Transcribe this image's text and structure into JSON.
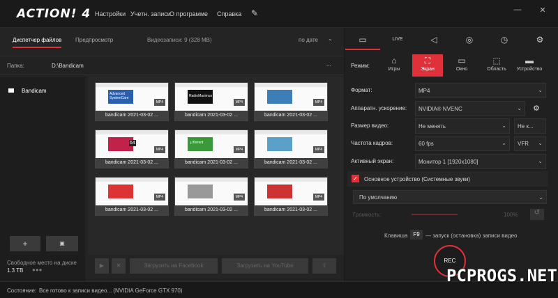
{
  "app": {
    "logo": "ACTION! 4"
  },
  "menu": [
    "Настройки",
    "Учетн. записи",
    "О программе",
    "Справка"
  ],
  "window": {
    "minimize": "—",
    "close": "✕"
  },
  "tabs": {
    "files": "Диспетчер файлов",
    "preview": "Предпросмотр",
    "count": "Видеозаписи: 9 (328 MB)",
    "sort": "по дате"
  },
  "path": {
    "label": "Папка:",
    "value": "D:\\Bandicam",
    "more": "..."
  },
  "folders": [
    {
      "name": "Bandicam"
    }
  ],
  "thumbs": [
    {
      "name": "bandicam 2021-03-02 ...",
      "fmt": "MP4",
      "logo": "Advanced SystemCare",
      "color": "#2a5fb0"
    },
    {
      "name": "bandicam 2021-03-02 ...",
      "fmt": "MP4",
      "logo": "RadioMaximus",
      "color": "#111"
    },
    {
      "name": "bandicam 2021-03-02 ...",
      "fmt": "MP4",
      "logo": "",
      "color": "#3c7fb8"
    },
    {
      "name": "bandicam 2021-03-02 ...",
      "fmt": "MP4",
      "logo": "64",
      "color": "#c0224a"
    },
    {
      "name": "bandicam 2021-03-02 ...",
      "fmt": "MP4",
      "logo": "μTorrent",
      "color": "#3a9a3a"
    },
    {
      "name": "bandicam 2021-03-02 ...",
      "fmt": "MP4",
      "logo": "",
      "color": "#5aa0c8"
    },
    {
      "name": "bandicam 2021-03-02 ...",
      "fmt": "MP4",
      "logo": "",
      "color": "#d33"
    },
    {
      "name": "bandicam 2021-03-02 ...",
      "fmt": "MP4",
      "logo": "",
      "color": "#999"
    },
    {
      "name": "bandicam 2021-03-02 ...",
      "fmt": "MP4",
      "logo": "",
      "color": "#c33"
    }
  ],
  "bottom": {
    "add": "+",
    "free_label": "Свободное место на диске",
    "free_value": "1.3 TB",
    "play": "▶",
    "delete": "✕",
    "facebook": "Загрузить на Facebook",
    "youtube": "Загрузить на YouTube"
  },
  "right_tabs": [
    "video-icon",
    "LIVE",
    "audio-icon",
    "camera-icon",
    "timer-icon",
    "gear-icon"
  ],
  "mode": {
    "label": "Режим:",
    "items": [
      {
        "label": "Игры",
        "icon": "gamepad-icon"
      },
      {
        "label": "Экран",
        "icon": "screen-icon",
        "active": true
      },
      {
        "label": "Окно",
        "icon": "window-icon"
      },
      {
        "label": "Область",
        "icon": "area-icon"
      },
      {
        "label": "Устройство",
        "icon": "device-icon"
      }
    ]
  },
  "settings": {
    "format": {
      "label": "Формат:",
      "value": "MP4"
    },
    "accel": {
      "label": "Аппаратн. ускорение:",
      "value": "NVIDIA® NVENC"
    },
    "size": {
      "label": "Размер видео:",
      "value": "Не менять",
      "extra": "Не к..."
    },
    "fps": {
      "label": "Частота кадров:",
      "value": "60 fps",
      "extra": "VFR"
    },
    "screen": {
      "label": "Активный экран:",
      "value": "Монитор 1 [1920x1080]"
    }
  },
  "audio": {
    "device_label": "Основное устройство (Системные звуки)",
    "device_value": "По умолчанию",
    "volume_label": "Громкость:",
    "volume_value": "100%"
  },
  "hotkey": {
    "prefix": "Клавиша",
    "key": "F9",
    "suffix": "— запуск (остановка) записи видео"
  },
  "rec": "REC",
  "status": {
    "label": "Состояние:",
    "text": "Все готово к записи видео...   (NVIDIA GeForce GTX 970)"
  },
  "watermark": "PCPROGS.NET",
  "colors": {
    "accent": "#e0303a"
  }
}
